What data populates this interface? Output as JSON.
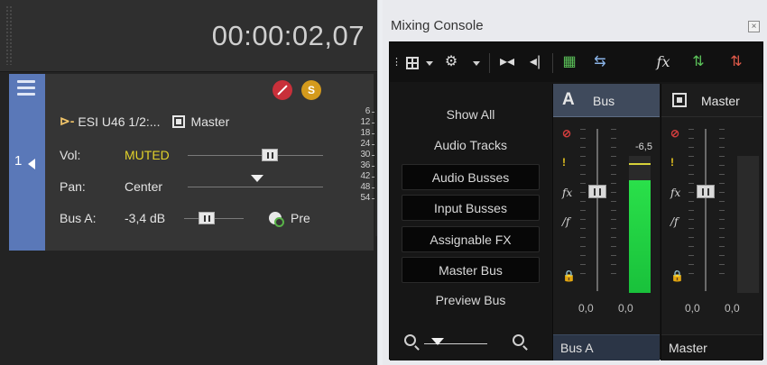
{
  "track_header": {
    "timecode": "00:00:02,07"
  },
  "track": {
    "number": "1",
    "io_device": "ESI U46 1/2:...",
    "io_output": "Master",
    "vol_label": "Vol:",
    "vol_value": "MUTED",
    "pan_label": "Pan:",
    "pan_value": "Center",
    "bus_label": "Bus A:",
    "bus_value": "-3,4 dB",
    "pre_label": "Pre",
    "mute_badge": "",
    "solo_badge": "S",
    "meter_scale": [
      "6",
      "12",
      "18",
      "24",
      "30",
      "36",
      "42",
      "48",
      "54"
    ]
  },
  "mixer": {
    "title": "Mixing Console",
    "close_glyph": "×",
    "views": [
      "Show All",
      "Audio Tracks",
      "Audio Busses",
      "Input Busses",
      "Assignable FX",
      "Master Bus",
      "Preview Bus"
    ],
    "active_views": [
      2,
      3,
      4,
      5
    ],
    "bus_channel": {
      "letter": "A",
      "title": "Bus",
      "peak": "-6,5",
      "value_left": "0,0",
      "value_right": "0,0",
      "footer": "Bus A",
      "meter_level": 0.82
    },
    "master_channel": {
      "title": "Master",
      "value_left": "0,0",
      "value_right": "0,0",
      "footer": "Master"
    }
  },
  "colors": {
    "track_strip": "#5a78b8",
    "muted_text": "#e2d22a",
    "meter_green": "#2ae04a",
    "mute_red": "#c8303a",
    "solo_gold": "#d49a1c"
  },
  "icons": {
    "track": [
      "hamburger-menu-icon",
      "mute-icon",
      "solo-icon",
      "input-arrow-icon",
      "master-output-icon",
      "send-pre-icon"
    ],
    "toolbar": [
      "grid-icon",
      "gear-icon",
      "insert-track-icon",
      "insert-bus-icon",
      "insert-fx-icon",
      "downmix-icon",
      "fx-icon",
      "add-channel-icon",
      "add-channel-red-icon"
    ],
    "channel": [
      "mute-icon",
      "solo-icon",
      "fx-icon",
      "fx-bypass-icon",
      "lock-icon"
    ]
  }
}
